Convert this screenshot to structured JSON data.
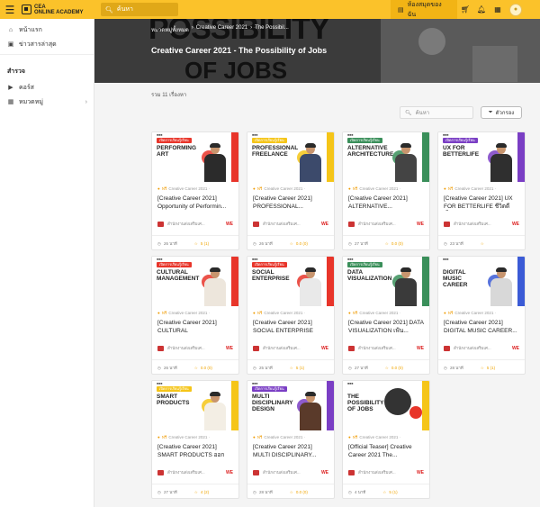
{
  "topbar": {
    "logo_line1": "CEA",
    "logo_line2": "ONLINE ACADEMY",
    "search_placeholder": "ค้นหา",
    "my_room_label": "ห้องสมุดของฉัน"
  },
  "sidebar": {
    "items_top": [
      {
        "label": "หน้าแรก",
        "icon": "home-icon"
      },
      {
        "label": "ข่าวสารล่าสุด",
        "icon": "news-icon"
      }
    ],
    "section_title": "สำรวจ",
    "items_explore": [
      {
        "label": "คอร์ส",
        "icon": "play-circle-icon"
      },
      {
        "label": "หมวดหมู่",
        "icon": "category-icon"
      }
    ]
  },
  "banner": {
    "breadcrumb": [
      "หมวดหมู่ทั้งหมด",
      "Creative Career 2021",
      "The Possibil..."
    ],
    "title": "Creative Career 2021 - The Possibility of Jobs",
    "bg_word1": "POSSIBILITY",
    "bg_word2": "OF JOBS"
  },
  "listing": {
    "count_text": "รวม 11 เรื่องหา",
    "search_placeholder": "ค้นหา",
    "filter_label": "ตัวกรอง"
  },
  "courses": [
    {
      "thumb_word": "PERFORMING ART",
      "tag": "เปิดการเรียนรู้เรียน",
      "meta_free": "ฟรี",
      "meta_text": "Creative Career 2021 ·",
      "title": "[Creative Career 2021] Opportunity of Performin...",
      "institute": "สำนักงานส่งเสริมเศ...",
      "badge": "WE",
      "duration": "26 นาที",
      "rating": "5 (1)",
      "accent": "#e8352a",
      "stripe": "#e8352a",
      "shirt": "#2b2b2b"
    },
    {
      "thumb_word": "PROFESSIONAL FREELANCE",
      "tag": "เปิดการเรียนรู้เรียน",
      "meta_free": "ฟรี",
      "meta_text": "Creative Career 2021 ·",
      "title": "[Creative Career 2021] PROFESSIONAL...",
      "institute": "สำนักงานส่งเสริมเศ...",
      "badge": "WE",
      "duration": "26 นาที",
      "rating": "0.0 (0)",
      "accent": "#f5c518",
      "stripe": "#f5c518",
      "shirt": "#3c4a6b"
    },
    {
      "thumb_word": "ALTERNATIVE ARCHITECTURE",
      "tag": "เปิดการเรียนรู้เรียน",
      "meta_free": "ฟรี",
      "meta_text": "Creative Career 2021 ·",
      "title": "[Creative Career 2021] ALTERNATIVE...",
      "institute": "สำนักงานส่งเสริมเศ...",
      "badge": "WE",
      "duration": "27 นาที",
      "rating": "0.0 (0)",
      "accent": "#3a8f5a",
      "stripe": "#3a8f5a",
      "shirt": "#444444"
    },
    {
      "thumb_word": "UX FOR BETTERLIFE",
      "tag": "เปิดการเรียนรู้เรียน",
      "meta_free": "ฟรี",
      "meta_text": "Creative Career 2021 ·",
      "title": "[Creative Career 2021] UX FOR BETTERLIFE ชีวิตดีขึ้น...",
      "institute": "สำนักงานส่งเสริมเศ...",
      "badge": "WE",
      "duration": "23 นาที",
      "rating": "",
      "accent": "#7a3ec4",
      "stripe": "#7a3ec4",
      "shirt": "#2f2f2f"
    },
    {
      "thumb_word": "CULTURAL MANAGEMENT",
      "tag": "เปิดการเรียนรู้เรียน",
      "meta_free": "ฟรี",
      "meta_text": "Creative Career 2021 ·",
      "title": "[Creative Career 2021] CULTURAL MANAGEMENT...",
      "institute": "สำนักงานส่งเสริมเศ...",
      "badge": "WE",
      "duration": "26 นาที",
      "rating": "0.0 (0)",
      "accent": "#e8352a",
      "stripe": "#e8352a",
      "shirt": "#ede6dc"
    },
    {
      "thumb_word": "SOCIAL ENTERPRISE",
      "tag": "เปิดการเรียนรู้เรียน",
      "meta_free": "ฟรี",
      "meta_text": "Creative Career 2021 ·",
      "title": "[Creative Career 2021] SOCIAL ENTERPRISE พัฒ...",
      "institute": "สำนักงานส่งเสริมเศ...",
      "badge": "WE",
      "duration": "25 นาที",
      "rating": "5 (1)",
      "accent": "#e8352a",
      "stripe": "#e8352a",
      "shirt": "#e9e9e9"
    },
    {
      "thumb_word": "DATA VISUALIZATION",
      "tag": "เปิดการเรียนรู้เรียน",
      "meta_free": "ฟรี",
      "meta_text": "Creative Career 2021 ·",
      "title": "[Creative Career 2021] DATA VISUALIZATION เฟ้น...",
      "institute": "สำนักงานส่งเสริมเศ...",
      "badge": "WE",
      "duration": "27 นาที",
      "rating": "0.0 (0)",
      "accent": "#3a8f5a",
      "stripe": "#3a8f5a",
      "shirt": "#3a3a3a"
    },
    {
      "thumb_word": "DIGITAL MUSIC CAREER",
      "tag": "",
      "meta_free": "ฟรี",
      "meta_text": "Creative Career 2021 ·",
      "title": "[Creative Career 2021] DIGITAL MUSIC CAREER...",
      "institute": "สำนักงานส่งเสริมเศ...",
      "badge": "WE",
      "duration": "28 นาที",
      "rating": "5 (1)",
      "accent": "#3b5bd6",
      "stripe": "#3b5bd6",
      "shirt": "#d8d8d8"
    },
    {
      "thumb_word": "SMART PRODUCTS",
      "tag": "เปิดการเรียนรู้เรียน",
      "meta_free": "ฟรี",
      "meta_text": "Creative Career 2021 ·",
      "title": "[Creative Career 2021] SMART PRODUCTS ออกแบ...",
      "institute": "สำนักงานส่งเสริมเศ...",
      "badge": "WE",
      "duration": "27 นาที",
      "rating": "4 (2)",
      "accent": "#f5c518",
      "stripe": "#f5c518",
      "shirt": "#f3eee4"
    },
    {
      "thumb_word": "MULTI DISCIPLINARY DESIGN",
      "tag": "เปิดการเรียนรู้เรียน",
      "meta_free": "ฟรี",
      "meta_text": "Creative Career 2021 ·",
      "title": "[Creative Career 2021] MULTI DISCIPLINARY...",
      "institute": "สำนักงานส่งเสริมเศ...",
      "badge": "WE",
      "duration": "28 นาที",
      "rating": "0.0 (0)",
      "accent": "#7a3ec4",
      "stripe": "#7a3ec4",
      "shirt": "#5a3a2a"
    },
    {
      "thumb_word": "THE POSSIBILITY OF JOBS",
      "tag": "",
      "meta_free": "ฟรี",
      "meta_text": "Creative Career 2021 ·",
      "title": "[Official Teaser] Creative Career 2021 The...",
      "institute": "สำนักงานส่งเสริมเศ...",
      "badge": "WE",
      "duration": "4 นาที",
      "rating": "5 (1)",
      "accent": "#e8352a",
      "stripe": "#f5c518",
      "shirt": ""
    }
  ]
}
